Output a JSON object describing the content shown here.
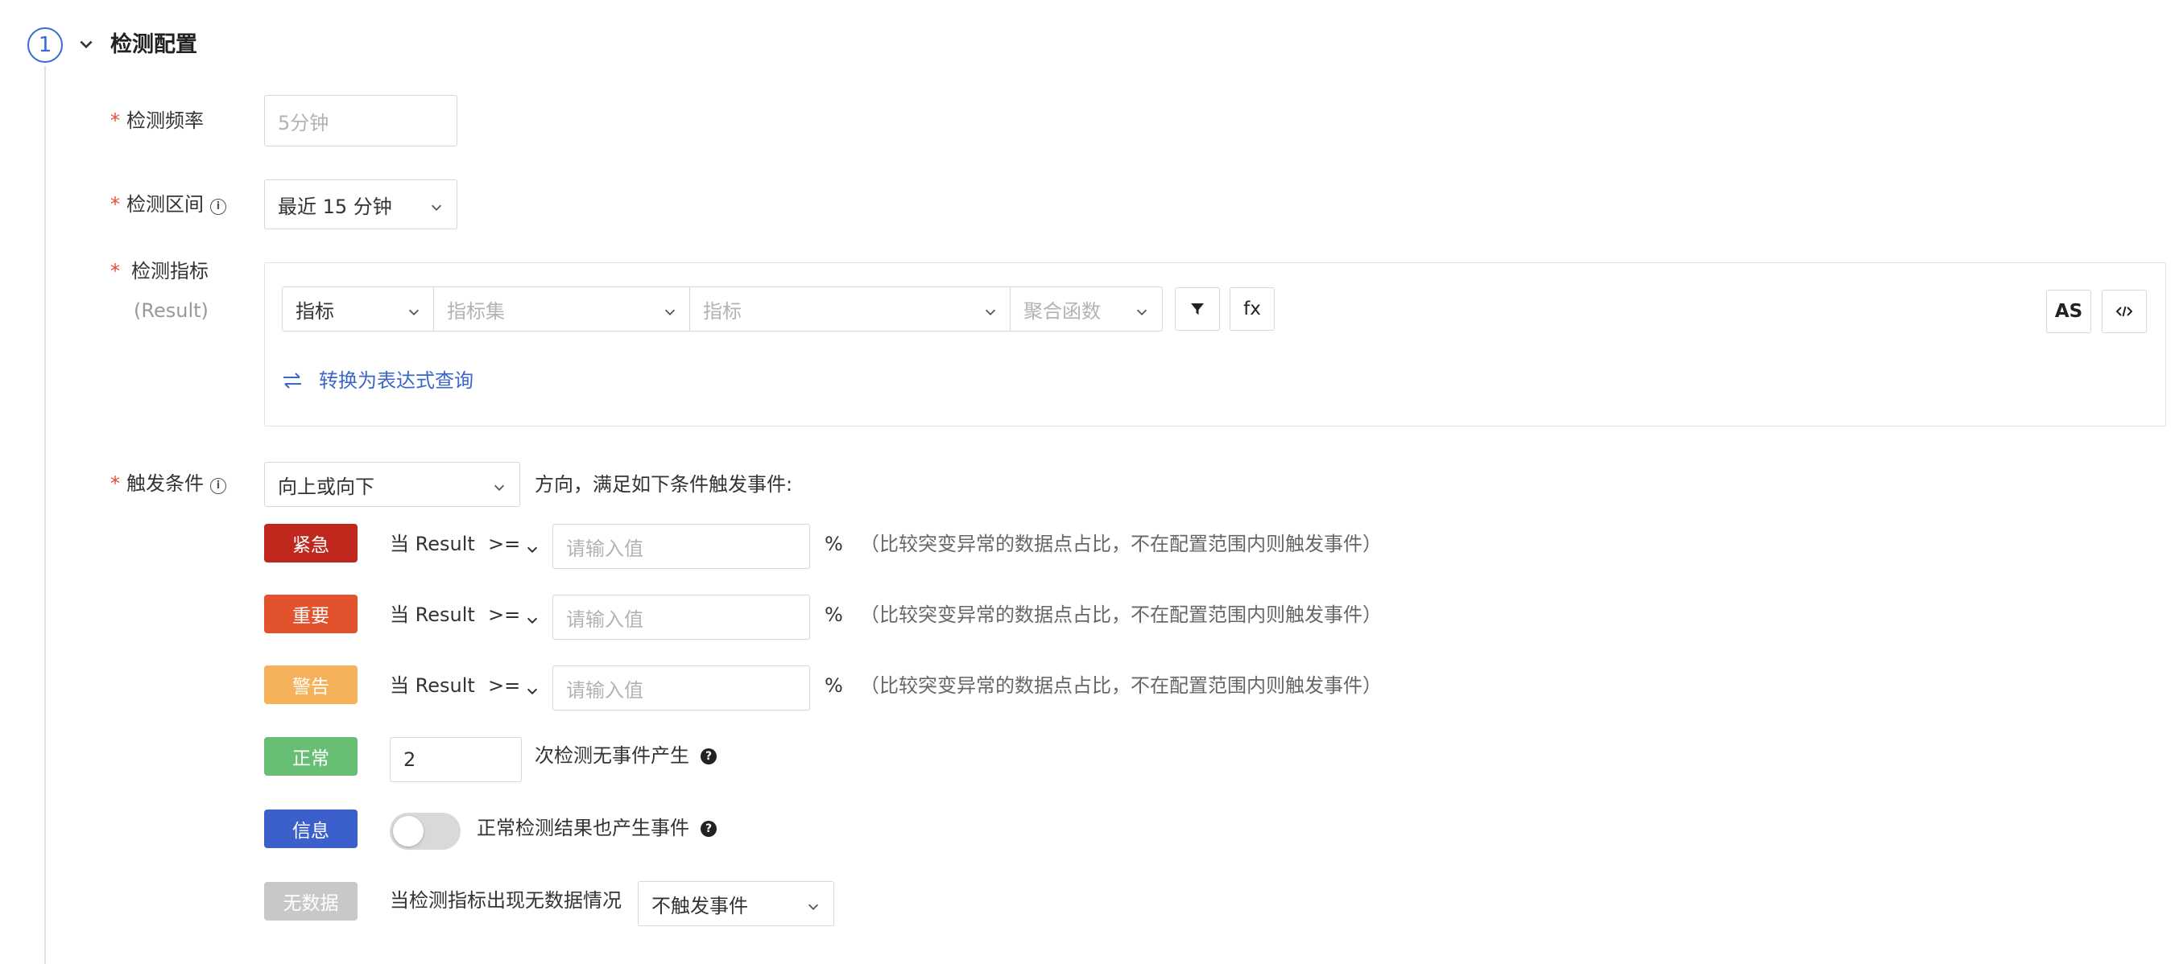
{
  "section": {
    "step_number": "1",
    "title": "检测配置"
  },
  "fields": {
    "frequency": {
      "label": "检测频率",
      "placeholder": "5分钟"
    },
    "interval": {
      "label": "检测区间",
      "value": "最近 15 分钟"
    },
    "metric": {
      "label": "检测指标",
      "sub_label": "(Result)",
      "source_type": "指标",
      "metric_set_placeholder": "指标集",
      "metric_placeholder": "指标",
      "aggregate_placeholder": "聚合函数",
      "fx_label": "fx",
      "as_label": "AS",
      "convert_link": "转换为表达式查询"
    },
    "trigger": {
      "label": "触发条件",
      "direction_value": "向上或向下",
      "direction_suffix": "方向，满足如下条件触发事件:"
    }
  },
  "conditions": {
    "critical": {
      "badge": "紧急",
      "prefix": "当 Result",
      "operator": ">=",
      "placeholder": "请输入值",
      "unit": "%",
      "hint": "（比较突变异常的数据点占比，不在配置范围内则触发事件）"
    },
    "major": {
      "badge": "重要",
      "prefix": "当 Result",
      "operator": ">=",
      "placeholder": "请输入值",
      "unit": "%",
      "hint": "（比较突变异常的数据点占比，不在配置范围内则触发事件）"
    },
    "warning": {
      "badge": "警告",
      "prefix": "当 Result",
      "operator": ">=",
      "placeholder": "请输入值",
      "unit": "%",
      "hint": "（比较突变异常的数据点占比，不在配置范围内则触发事件）"
    },
    "normal": {
      "badge": "正常",
      "value": "2",
      "suffix": "次检测无事件产生"
    },
    "info": {
      "badge": "信息",
      "toggle_on": false,
      "label": "正常检测结果也产生事件"
    },
    "nodata": {
      "badge": "无数据",
      "label": "当检测指标出现无数据情况",
      "value": "不触发事件"
    }
  },
  "colors": {
    "critical": "#c0281d",
    "major": "#e2532d",
    "warning": "#f5b25a",
    "normal": "#66bf73",
    "info": "#3b5fcb",
    "nodata": "#c8c8c8",
    "accent": "#3a6ad6",
    "required": "#e34d35"
  }
}
